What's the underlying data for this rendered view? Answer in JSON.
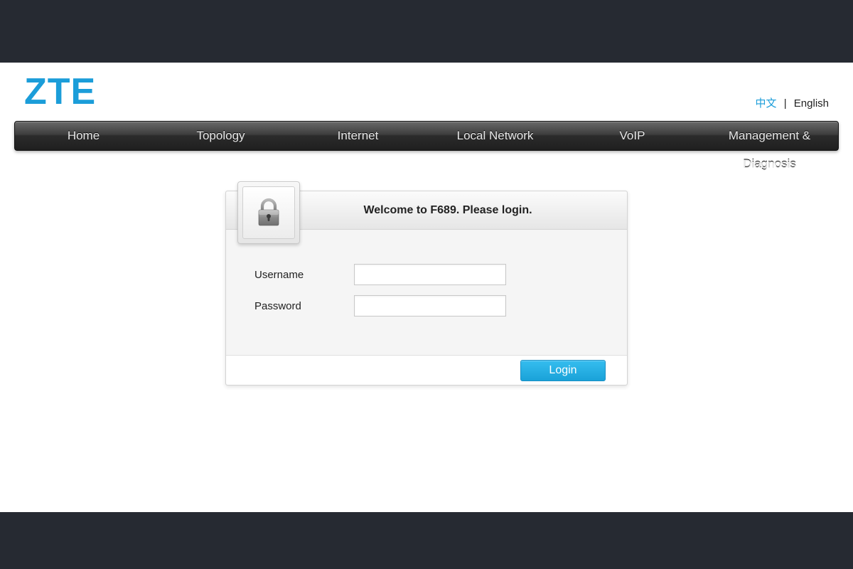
{
  "brand": {
    "logo_text": "ZTE"
  },
  "lang": {
    "zh": "中文",
    "sep": "|",
    "en": "English"
  },
  "nav": {
    "items": [
      {
        "label": "Home"
      },
      {
        "label": "Topology"
      },
      {
        "label": "Internet"
      },
      {
        "label": "Local Network"
      },
      {
        "label": "VoIP"
      },
      {
        "label": "Management & Diagnosis"
      }
    ]
  },
  "login": {
    "welcome": "Welcome to F689. Please login.",
    "username_label": "Username",
    "password_label": "Password",
    "username_value": "",
    "password_value": "",
    "button_label": "Login"
  },
  "colors": {
    "accent": "#1b9dd9",
    "button": "#1aa2d8",
    "dark": "#262a32"
  }
}
